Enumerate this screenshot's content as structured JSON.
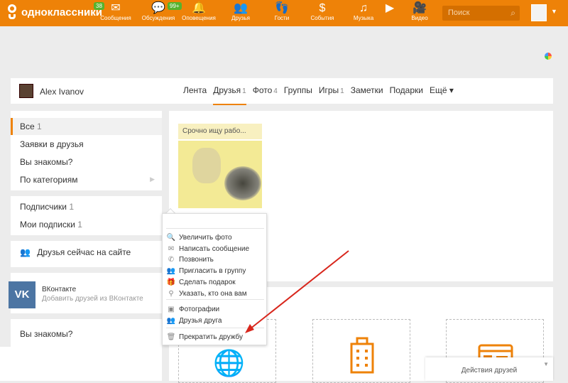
{
  "topbar": {
    "logo_text": "одноклассники",
    "nav": [
      {
        "label": "Сообщения",
        "icon": "envelope-icon",
        "glyph": "✉",
        "badge": "38"
      },
      {
        "label": "Обсуждения",
        "icon": "chat-icon",
        "glyph": "💬",
        "badge": "99+"
      },
      {
        "label": "Оповещения",
        "icon": "bell-icon",
        "glyph": "🔔",
        "badge": ""
      },
      {
        "label": "Друзья",
        "icon": "friends-icon",
        "glyph": "👥",
        "badge": ""
      },
      {
        "label": "Гости",
        "icon": "footprints-icon",
        "glyph": "👣",
        "badge": ""
      },
      {
        "label": "События",
        "icon": "events-icon",
        "glyph": "$",
        "badge": ""
      },
      {
        "label": "Музыка",
        "icon": "music-icon",
        "glyph": "♫",
        "badge": ""
      },
      {
        "label": "",
        "icon": "video-play-icon",
        "glyph": "▶",
        "badge": ""
      },
      {
        "label": "Видео",
        "icon": "video-camera-icon",
        "glyph": "🎥",
        "badge": ""
      }
    ],
    "search_placeholder": "Поиск"
  },
  "profile": {
    "name": "Alex Ivanov",
    "tabs": [
      {
        "label": "Лента",
        "count": ""
      },
      {
        "label": "Друзья",
        "count": "1"
      },
      {
        "label": "Фото",
        "count": "4"
      },
      {
        "label": "Группы",
        "count": ""
      },
      {
        "label": "Игры",
        "count": "1"
      },
      {
        "label": "Заметки",
        "count": ""
      },
      {
        "label": "Подарки",
        "count": ""
      },
      {
        "label": "Ещё ▾",
        "count": ""
      }
    ]
  },
  "sidebar": {
    "all_label": "Все",
    "all_count": "1",
    "requests": "Заявки в друзья",
    "maybe_know": "Вы знакомы?",
    "by_category": "По категориям",
    "subscribers": "Подписчики",
    "subscribers_count": "1",
    "my_subs": "Мои подписки",
    "my_subs_count": "1",
    "online": "Друзья сейчас на сайте",
    "vk_logo": "VK",
    "vk_title": "ВКонтакте",
    "vk_sub": "Добавить друзей из ВКонтакте",
    "maybe_know2": "Вы знакомы?"
  },
  "friend": {
    "name": "Срочно ищу рабо..."
  },
  "menu": {
    "items": [
      {
        "label": "Увеличить фото",
        "icon": "zoom-icon",
        "glyph": "🔍"
      },
      {
        "label": "Написать сообщение",
        "icon": "envelope-icon",
        "glyph": "✉"
      },
      {
        "label": "Позвонить",
        "icon": "phone-icon",
        "glyph": "✆"
      },
      {
        "label": "Пригласить в группу",
        "icon": "group-icon",
        "glyph": "👥"
      },
      {
        "label": "Сделать подарок",
        "icon": "gift-icon",
        "glyph": "🎁"
      },
      {
        "label": "Указать, кто она вам",
        "icon": "pin-icon",
        "glyph": "⚲"
      },
      {
        "label": "Фотографии",
        "icon": "photos-icon",
        "glyph": "▣"
      },
      {
        "label": "Друзья друга",
        "icon": "friends-icon",
        "glyph": "👥"
      },
      {
        "label": "Прекратить дружбу",
        "icon": "trash-icon",
        "glyph": "🗑"
      }
    ]
  },
  "actions_label": "Действия друзей"
}
